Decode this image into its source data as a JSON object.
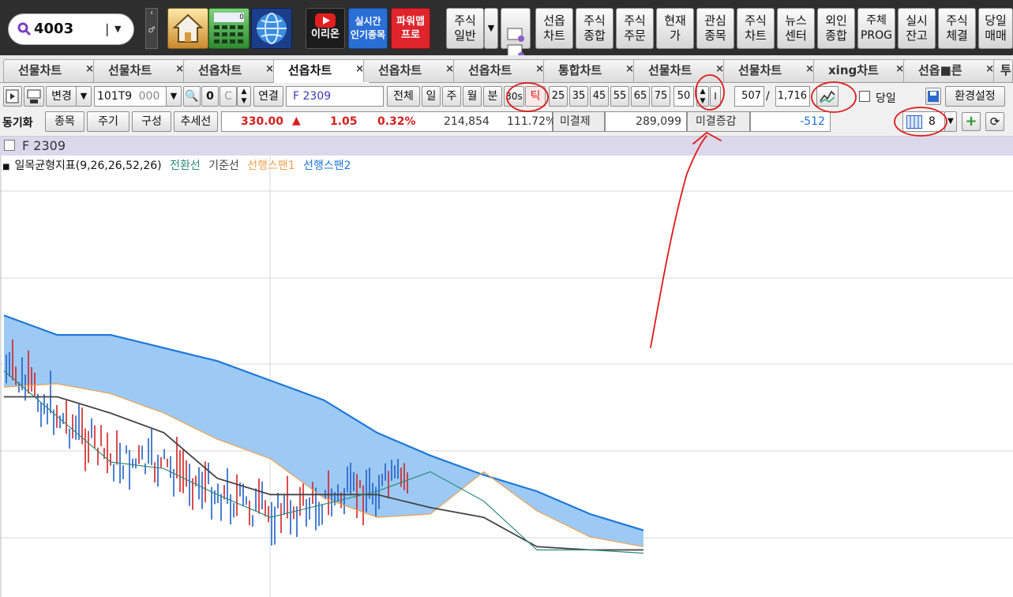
{
  "search": {
    "value": "4003"
  },
  "topbar": {
    "red_buttons": [
      {
        "label": "이리온"
      },
      {
        "label": "실시간\n인기종목"
      },
      {
        "label": "파워맵\n프로"
      }
    ],
    "menu": [
      {
        "label": "주식\n일반"
      },
      {
        "label": "선옵\n차트"
      },
      {
        "label": "주식\n종합"
      },
      {
        "label": "주식\n주문"
      },
      {
        "label": "현재\n가"
      },
      {
        "label": "관심\n종목"
      },
      {
        "label": "주식\n차트"
      },
      {
        "label": "뉴스\n센터"
      },
      {
        "label": "외인\n종합"
      },
      {
        "label": "주체\nPROG"
      },
      {
        "label": "실시\n잔고"
      },
      {
        "label": "주식\n체결"
      },
      {
        "label": "당일\n매매"
      }
    ],
    "calc_display": "0"
  },
  "tabs": [
    {
      "label": "선물차트"
    },
    {
      "label": "선물차트"
    },
    {
      "label": "선옵차트"
    },
    {
      "label": "선옵차트"
    },
    {
      "label": "선옵차트"
    },
    {
      "label": "선옵차트"
    },
    {
      "label": "통합차트"
    },
    {
      "label": "선물차트"
    },
    {
      "label": "선물차트"
    },
    {
      "label": "xing차트"
    },
    {
      "label": "선옵■른"
    },
    {
      "label": "투"
    }
  ],
  "tab_close": "×",
  "toolbar": {
    "change_label": "변경",
    "code_value": "101T9",
    "code_suffix": "000",
    "link_label": "연결",
    "symbol_name": "F 2309",
    "period_all": "전체",
    "period_day": "일",
    "period_week": "주",
    "period_month": "월",
    "period_minute": "분",
    "period_30s": "30s",
    "period_tick": "틱",
    "tick_values": [
      "25",
      "35",
      "45",
      "55",
      "65",
      "75"
    ],
    "tick_count": "50",
    "bar_position": "507",
    "slash": "/",
    "bar_total": "1,716",
    "today_label": "당일",
    "env_label": "환경설정"
  },
  "row2": {
    "sync_label": "동기화",
    "btn_stock": "종목",
    "btn_period": "주기",
    "btn_config": "구성",
    "btn_trend": "추세선",
    "price": "330.00",
    "arrow": "▲",
    "change": "1.05",
    "change_pct": "0.32%",
    "volume": "214,854",
    "volume_ratio": "111.72%",
    "oi_label": "미결제",
    "oi_value": "289,099",
    "oi_change_label": "미결증감",
    "oi_change_value": "-512",
    "grid_count": "8"
  },
  "chart": {
    "symbol_title": "F 2309",
    "indicator": "일목균형지표(9,26,26,52,26)",
    "series": [
      {
        "name": "전환선",
        "color": "#2e8b7a"
      },
      {
        "name": "기준선",
        "color": "#444444"
      },
      {
        "name": "선행스팬1",
        "color": "#f0a050"
      },
      {
        "name": "선행스팬2",
        "color": "#1e78d8"
      }
    ]
  },
  "colors": {
    "annotation": "#e01818",
    "up": "#d42020",
    "down": "#1f5fc8",
    "cloud_bull": "#9ccaf5",
    "cloud_bear": "#f8c28a"
  },
  "chart_data": {
    "type": "line",
    "title": "",
    "series": [
      {
        "name": "선행스팬2",
        "values": [
          5.2,
          4.6,
          4.6,
          4.2,
          3.8,
          3.2,
          2.6,
          1.6,
          0.9,
          0.3,
          -0.2,
          -0.9,
          -1.4
        ]
      },
      {
        "name": "선행스팬1",
        "values": [
          3.0,
          3.1,
          2.8,
          2.2,
          1.4,
          0.8,
          -0.4,
          -1.0,
          -0.9,
          0.4,
          -0.8,
          -1.6,
          -1.9
        ]
      },
      {
        "name": "기준선",
        "values": [
          2.7,
          2.7,
          2.2,
          1.6,
          0.2,
          -0.3,
          -0.3,
          -0.3,
          -0.7,
          -1.0,
          -1.9,
          -2.0,
          -2.0
        ]
      },
      {
        "name": "전환선",
        "values": [
          3.5,
          2.1,
          0.7,
          0.5,
          -0.3,
          -1.0,
          -0.6,
          -0.2,
          0.4,
          -0.5,
          -2.0,
          -2.0,
          -2.1
        ]
      }
    ],
    "grid": true
  }
}
